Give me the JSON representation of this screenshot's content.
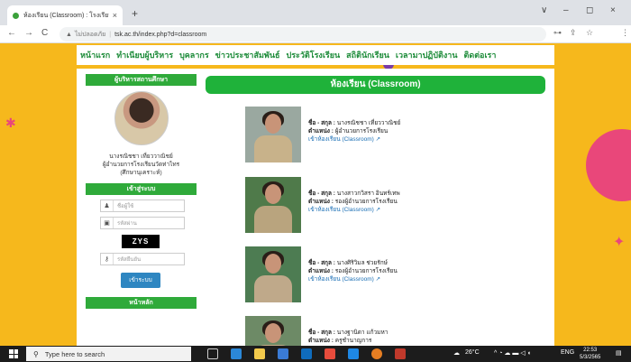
{
  "browser": {
    "tab_title": "ห้องเรียน (Classroom) : โรงเรียนวัด",
    "tab_close": "×",
    "new_tab": "+",
    "win_min": "∨",
    "win_max": "–",
    "win_restore": "◻",
    "win_close": "×",
    "back": "←",
    "forward": "→",
    "reload": "C",
    "insecure_label": "ไม่ปลอดภัย",
    "url": "tsk.ac.th/index.php?d=classroom"
  },
  "topnav": {
    "items": [
      "หน้าแรก",
      "ทำเนียบผู้บริหาร",
      "บุคลากร",
      "ข่าวประชาสัมพันธ์",
      "ประวัติโรงเรียน",
      "สถิตินักเรียน",
      "เวลามาปฏิบัติงาน",
      "ติดต่อเรา"
    ]
  },
  "sidebar": {
    "director_heading": "ผู้บริหารสถานศึกษา",
    "director_name": "นางรณิชชา เที่ยววาณิชย์",
    "director_position": "ผู้อำนวยการโรงเรียนวัดท่าไทร",
    "director_position2": "(ศึกษานุเคราะห์)",
    "login_heading": "เข้าสู่ระบบ",
    "username_placeholder": "ชื่อผู้ใช้",
    "password_placeholder": "รหัสผ่าน",
    "captcha_text": "ZYS",
    "captcha_placeholder": "รหัสยืนยัน",
    "login_button": "เข้าระบบ",
    "main_heading": "หน้าหลัก"
  },
  "content": {
    "heading": "ห้องเรียน (Classroom)",
    "name_label": "ชื่อ - สกุล :",
    "position_label": "ตำแหน่ง :",
    "link_label": "เข้าห้องเรียน (Classroom)",
    "people": [
      {
        "name": "นางรณิชชา เที่ยววาณิชย์",
        "position": "ผู้อำนวยการโรงเรียน"
      },
      {
        "name": "นางสาวกวิสรา อินทร์เทพ",
        "position": "รองผู้อำนวยการโรงเรียน"
      },
      {
        "name": "นางศิริวิมล ช่วยรักษ์",
        "position": "รองผู้อำนวยการโรงเรียน"
      },
      {
        "name": "นางฐานิดา แก้วมหา",
        "position": "ครูชำนาญการ"
      }
    ]
  },
  "taskbar": {
    "search_placeholder": "Type here to search",
    "temperature": "26°C",
    "lang": "ENG",
    "time": "22:53",
    "date": "5/3/2565"
  }
}
